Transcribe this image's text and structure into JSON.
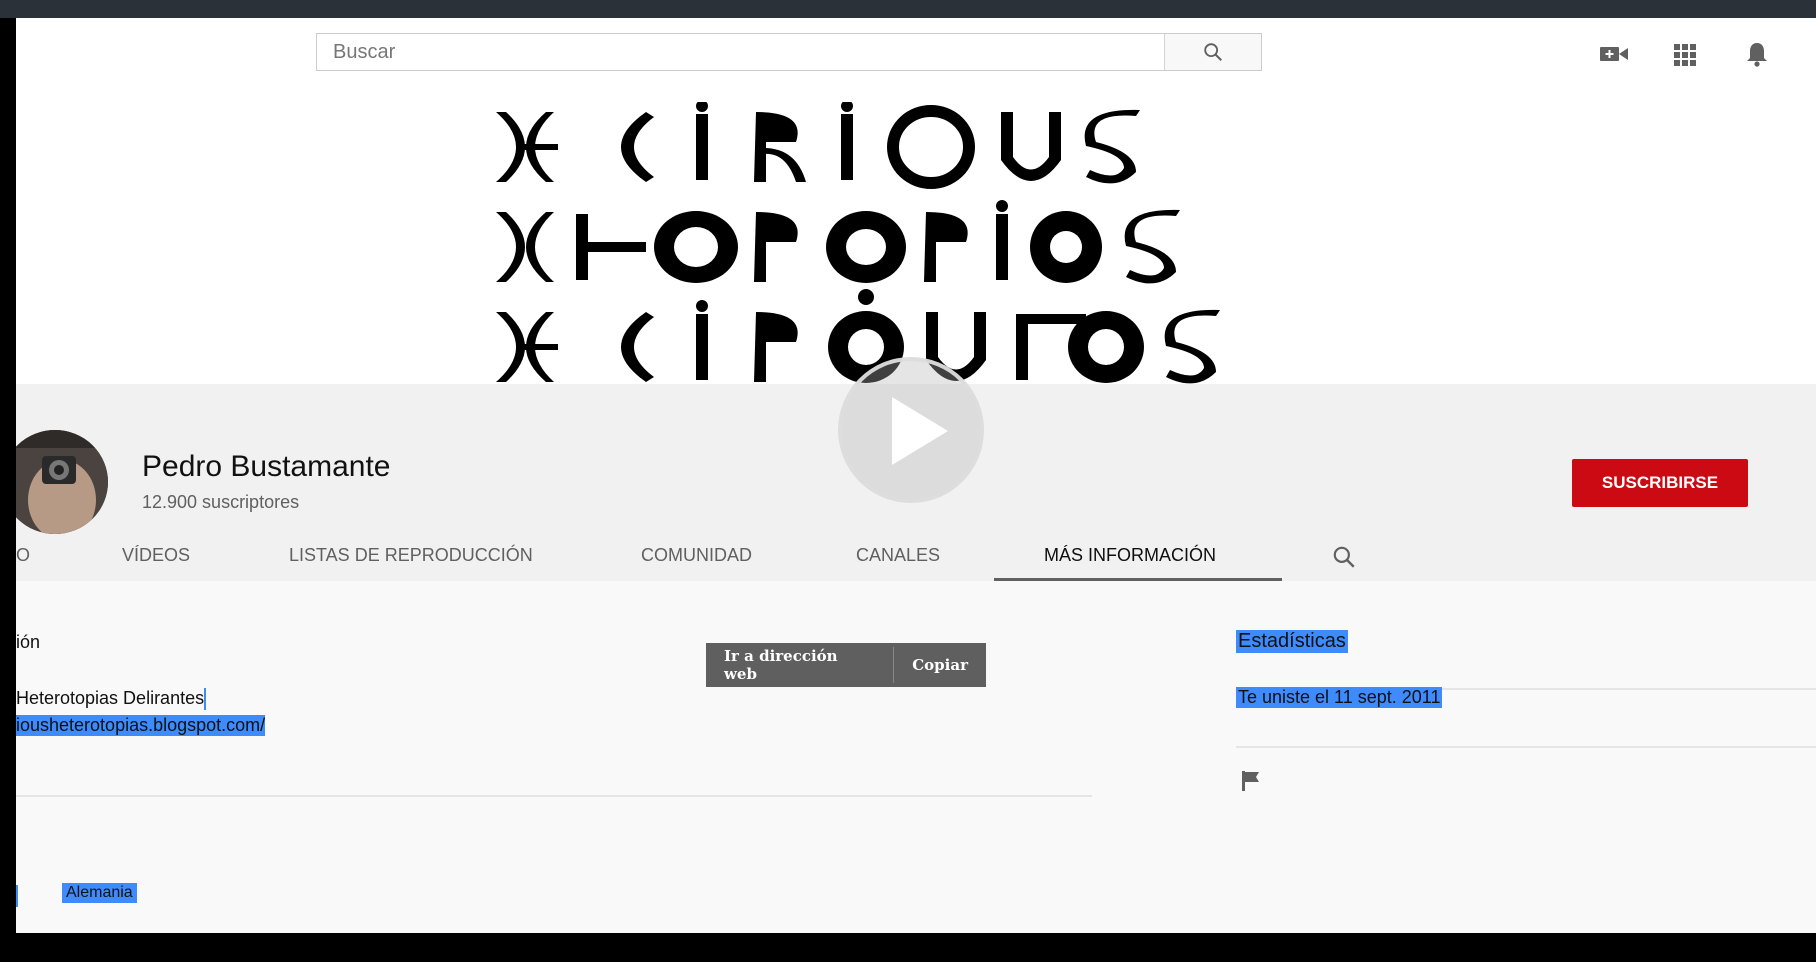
{
  "search": {
    "placeholder": "Buscar"
  },
  "masthead": {
    "icons": [
      "video-camera-icon",
      "apps-grid-icon",
      "bell-icon"
    ]
  },
  "channel": {
    "name": "Pedro Bustamante",
    "subscribers": "12.900 suscriptores",
    "subscribe_label": "SUSCRIBIRSE"
  },
  "tabs": [
    {
      "label": "O"
    },
    {
      "label": "VÍDEOS"
    },
    {
      "label": "LISTAS DE REPRODUCCIÓN"
    },
    {
      "label": "COMUNIDAD"
    },
    {
      "label": "CANALES"
    },
    {
      "label": "MÁS INFORMACIÓN"
    }
  ],
  "about": {
    "section_heading": "ión",
    "link_title": "Heterotopias Delirantes",
    "link_url": "iousheterotopias.blogspot.com/",
    "country_label": "Alemania"
  },
  "tooltip": {
    "open_label": "Ir a dirección web",
    "copy_label": "Copiar"
  },
  "stats": {
    "heading": "Estadísticas",
    "joined": "Te uniste el 11 sept. 2011"
  },
  "colors": {
    "subscribe": "#cc0a14",
    "selection": "#3d8bfd"
  }
}
